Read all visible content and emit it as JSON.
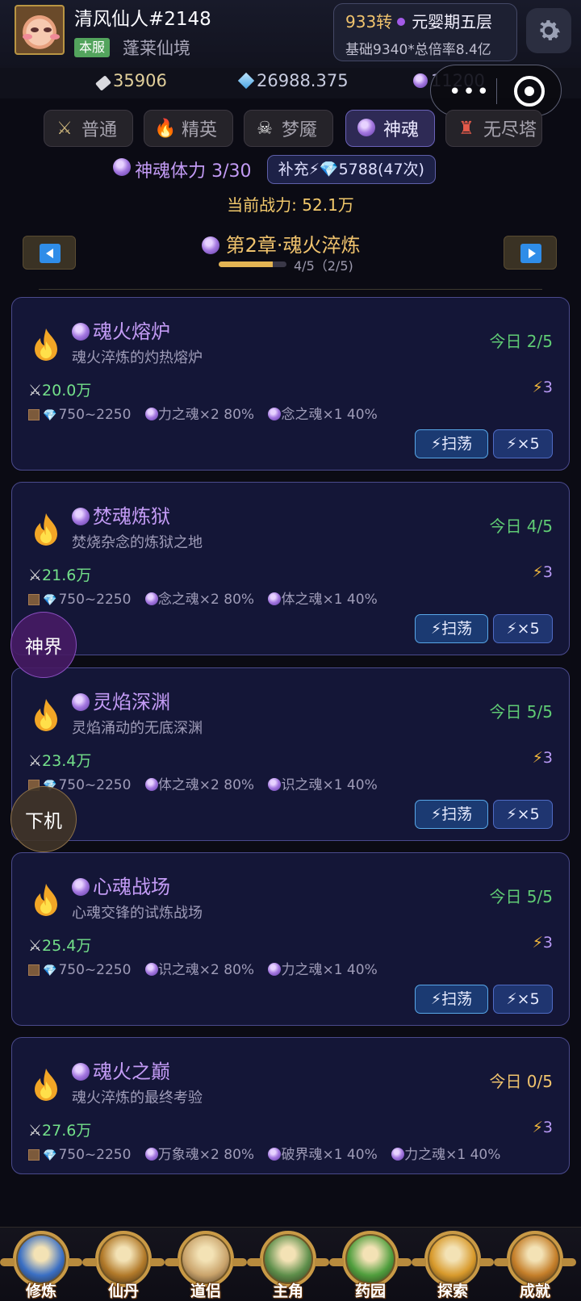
{
  "player": {
    "name": "清风仙人#2148",
    "server_badge": "本服",
    "server_name": "蓬莱仙境",
    "turn": "933转",
    "realm": "元婴期五层",
    "stats_line": "基础9340*总倍率8.4亿"
  },
  "currencies": {
    "ticket": "35906",
    "gem": "26988.375",
    "soul": "11200"
  },
  "tabs": [
    {
      "label": "普通",
      "icon": "crossed-swords-icon"
    },
    {
      "label": "精英",
      "icon": "fire-icon"
    },
    {
      "label": "梦魇",
      "icon": "skull-icon"
    },
    {
      "label": "神魂",
      "icon": "soul-orb-icon"
    },
    {
      "label": "无尽塔",
      "icon": "tower-icon"
    }
  ],
  "active_tab": "神魂",
  "stamina": {
    "label": "神魂体力 3/30",
    "refill_label": "补充⚡💎5788(47次)"
  },
  "power": "当前战力: 52.1万",
  "chapter": {
    "title": "第2章·魂火淬炼",
    "progress_text": "4/5（2/5)",
    "progress_fraction": 0.8
  },
  "stages": [
    {
      "name": "魂火熔炉",
      "desc": "魂火淬炼的灼热熔炉",
      "today": "今日 2/5",
      "power": "20.0万",
      "cost": "3",
      "rewards": [
        "750~2250",
        "力之魂×2 80%",
        "念之魂×1 40%"
      ],
      "sweep_label": "⚡扫荡",
      "x5_label": "⚡×5"
    },
    {
      "name": "焚魂炼狱",
      "desc": "焚烧杂念的炼狱之地",
      "today": "今日 4/5",
      "power": "21.6万",
      "cost": "3",
      "rewards": [
        "750~2250",
        "念之魂×2 80%",
        "体之魂×1 40%"
      ],
      "sweep_label": "⚡扫荡",
      "x5_label": "⚡×5"
    },
    {
      "name": "灵焰深渊",
      "desc": "灵焰涌动的无底深渊",
      "today": "今日 5/5",
      "power": "23.4万",
      "cost": "3",
      "rewards": [
        "750~2250",
        "体之魂×2 80%",
        "识之魂×1 40%"
      ],
      "sweep_label": "⚡扫荡",
      "x5_label": "⚡×5"
    },
    {
      "name": "心魂战场",
      "desc": "心魂交锋的试炼战场",
      "today": "今日 5/5",
      "power": "25.4万",
      "cost": "3",
      "rewards": [
        "750~2250",
        "识之魂×2 80%",
        "力之魂×1 40%"
      ],
      "sweep_label": "⚡扫荡",
      "x5_label": "⚡×5"
    },
    {
      "name": "魂火之巅",
      "desc": "魂火淬炼的最终考验",
      "today": "今日 0/5",
      "power": "27.6万",
      "cost": "3",
      "rewards": [
        "750~2250",
        "万象魂×2 80%",
        "破界魂×1 40%",
        "力之魂×1 40%"
      ]
    }
  ],
  "floating": {
    "divine": "神界",
    "logout": "下机"
  },
  "bottom_nav": [
    {
      "label": "修炼",
      "color": "#3a6fc4"
    },
    {
      "label": "仙丹",
      "color": "#b27a2a"
    },
    {
      "label": "道侣",
      "color": "#c9a36b"
    },
    {
      "label": "主角",
      "color": "#5d8e4a"
    },
    {
      "label": "药园",
      "color": "#4f9e3d"
    },
    {
      "label": "探索",
      "color": "#d89a2c"
    },
    {
      "label": "成就",
      "color": "#c57f2a"
    }
  ],
  "colors": {
    "accent_purple": "#c39bf5",
    "gold": "#f0c36d",
    "green": "#5fcb74",
    "card_bg": "#141637"
  }
}
